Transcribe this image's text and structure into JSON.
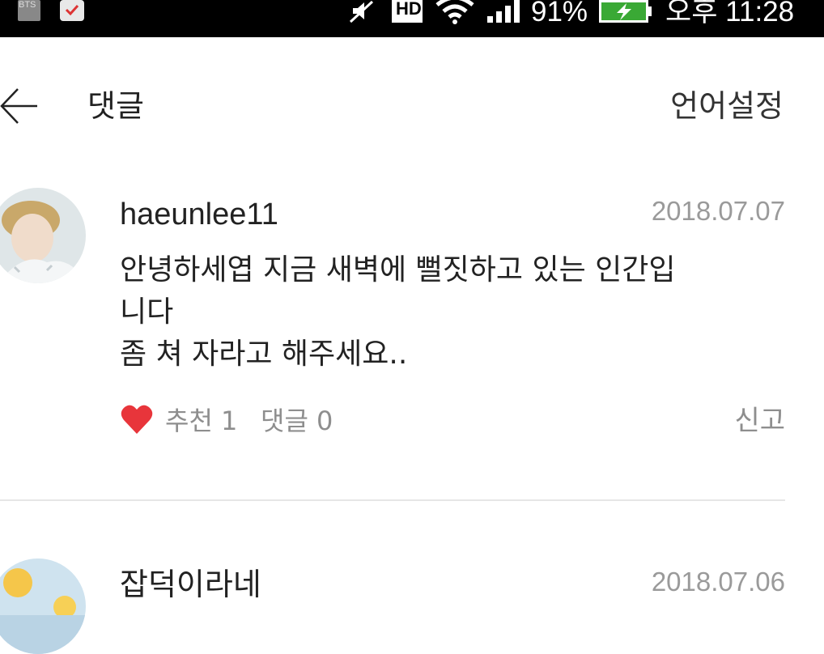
{
  "status_bar": {
    "battery": "91%",
    "time": "오후 11:28",
    "hd_label": "HD",
    "notification_label": "BTS"
  },
  "header": {
    "title": "댓글",
    "language_setting": "언어설정"
  },
  "comments": [
    {
      "username": "haeunlee11",
      "date": "2018.07.07",
      "lines": [
        "안녕하세엽 지금 새벽에 뻘짓하고 있는 인간입",
        "니다",
        "좀 쳐 자라고 해주세요.."
      ],
      "likes_label": "추천 1",
      "replies_label": "댓글 0",
      "report_label": "신고",
      "heart_color": "#e8353b"
    },
    {
      "username": "잡덕이라네",
      "date": "2018.07.06"
    }
  ]
}
